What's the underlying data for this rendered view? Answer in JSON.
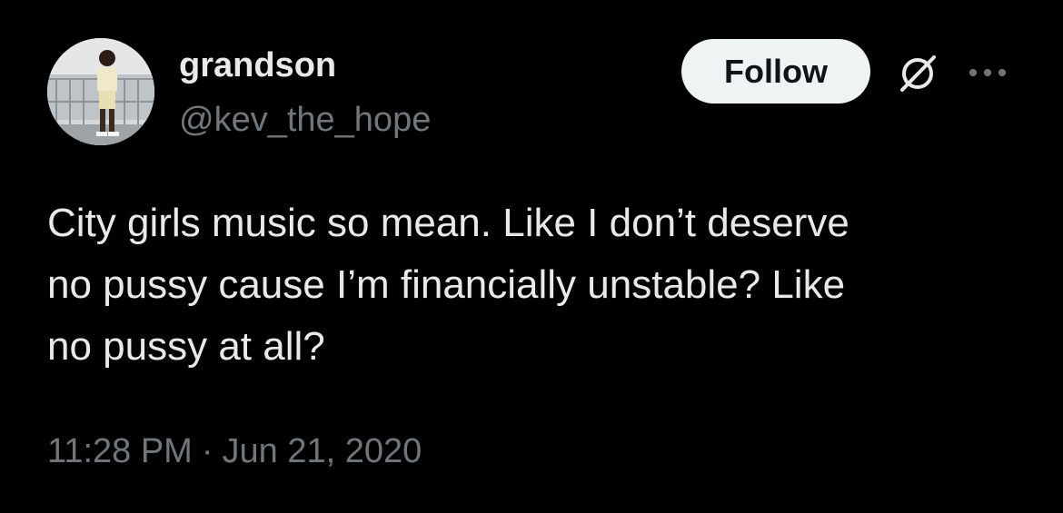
{
  "author": {
    "display_name": "grandson",
    "handle": "@kev_the_hope",
    "avatar_icon": "profile-photo"
  },
  "actions": {
    "follow_label": "Follow",
    "grok_icon": "grok-icon",
    "more_icon": "more-options-icon"
  },
  "tweet": {
    "text": "City girls music so mean. Like I don’t deserve\nno pussy cause I’m financially unstable? Like\nno pussy at all?",
    "time": "11:28 PM",
    "separator": "·",
    "date": "Jun 21, 2020"
  },
  "colors": {
    "background": "#000000",
    "primary_text": "#e7e9ea",
    "secondary_text": "#71767b",
    "follow_button_bg": "#eff3f4",
    "follow_button_text": "#0f1419"
  }
}
